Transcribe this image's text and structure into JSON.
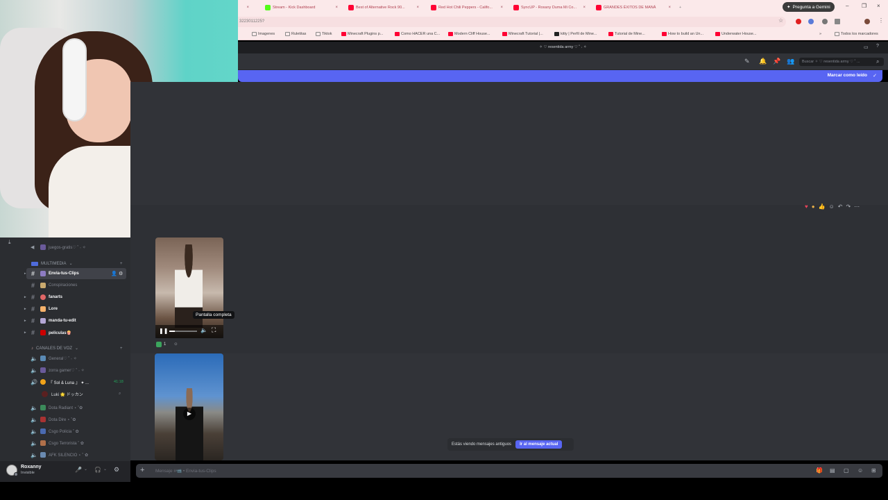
{
  "browser": {
    "tabs": [
      {
        "label": "Stream - Kick Dashboard",
        "fav_color": "#53fc18"
      },
      {
        "label": "Best of Alternative Rock 90...",
        "fav_color": "#ff0033"
      },
      {
        "label": "Red Hot Chili Peppers - Califo...",
        "fav_color": "#ff0033"
      },
      {
        "label": "SyncUP - Roxany Duma Mi Co...",
        "fav_color": "#ff0033"
      },
      {
        "label": "GRANDES ÉXITOS DE MANÁ",
        "fav_color": "#ff0033"
      }
    ],
    "gemini_label": "Pregunta a Gemini",
    "url_fragment": "3223011225?",
    "bookmarks": [
      {
        "label": "Imagenes"
      },
      {
        "label": "Ruletitas"
      },
      {
        "label": "Tiktok"
      },
      {
        "label": "Minecraft Plugins p..."
      },
      {
        "label": "Como HACER una C..."
      },
      {
        "label": "Modern Cliff House..."
      },
      {
        "label": "Minecraft Tutorial |..."
      },
      {
        "label": "kitty | Perfil de Mine..."
      },
      {
        "label": "Tutorial de Mine..."
      },
      {
        "label": "How to build an Un..."
      },
      {
        "label": "Underwater House..."
      }
    ],
    "all_bookmarks_label": "Todos los marcadores"
  },
  "discord": {
    "window_title": "✧ ♡ resentida army ♡ ˚ ˖ ✧",
    "search_placeholder": "Buscar ✧ ♡ resentida army ♡ ˚ ...",
    "mark_read_label": "Marcar como leído",
    "channels": [
      {
        "label": "juegos-gratis♡ ˚ ˖ ✧",
        "type": "text",
        "muted": true
      },
      {
        "category": "MULTIMEDIA"
      },
      {
        "label": "Envia-tus-Clips",
        "type": "text",
        "selected": true,
        "emoji_color": "#8e7cc3"
      },
      {
        "label": "Conspiraciones",
        "type": "text",
        "muted": true,
        "emoji_color": "#c9a96e"
      },
      {
        "label": "fanarts",
        "type": "text",
        "emoji_color": "#e06666"
      },
      {
        "label": "Lore",
        "type": "text",
        "emoji_color": "#f6b26b"
      },
      {
        "label": "manda-tu-edit",
        "type": "text",
        "emoji_color": "#b4a7d6"
      },
      {
        "label": "peliculas🍿",
        "type": "text",
        "emoji_color": "#cc0000"
      },
      {
        "category": "CANALES DE VOZ"
      },
      {
        "label": "General♡ ˚ ˖ ✧",
        "type": "voice"
      },
      {
        "label": "zorra gamer♡ ˚ ˖ ✧",
        "type": "voice"
      },
      {
        "label": "『 Sol & Luna 』 ✦ ...",
        "type": "voice",
        "active": true,
        "timer": "41:18"
      },
      {
        "label": "Luki 🌟 ドッカン",
        "type": "member"
      },
      {
        "label": "Dota Radiant ⋆ ˚✿",
        "type": "voice"
      },
      {
        "label": "Dota Dire ⋆ ˚✿",
        "type": "voice"
      },
      {
        "label": "Csgo Policia ˚ ✿",
        "type": "voice"
      },
      {
        "label": "Csgo Terrorista ˚ ✿",
        "type": "voice"
      },
      {
        "label": "AFK SILENCIO ⋆ ˚ ✿",
        "type": "voice"
      }
    ],
    "video_tooltip": "Pantalla completa",
    "reaction_count": "1",
    "old_messages_text": "Estás viendo mensajes antiguos",
    "jump_label": "Ir al mensaje actual",
    "composer_placeholder": "Mensaje #📹 • Envia-tus-Clips",
    "user": {
      "name": "Roxanny",
      "status": "Invisible"
    }
  }
}
